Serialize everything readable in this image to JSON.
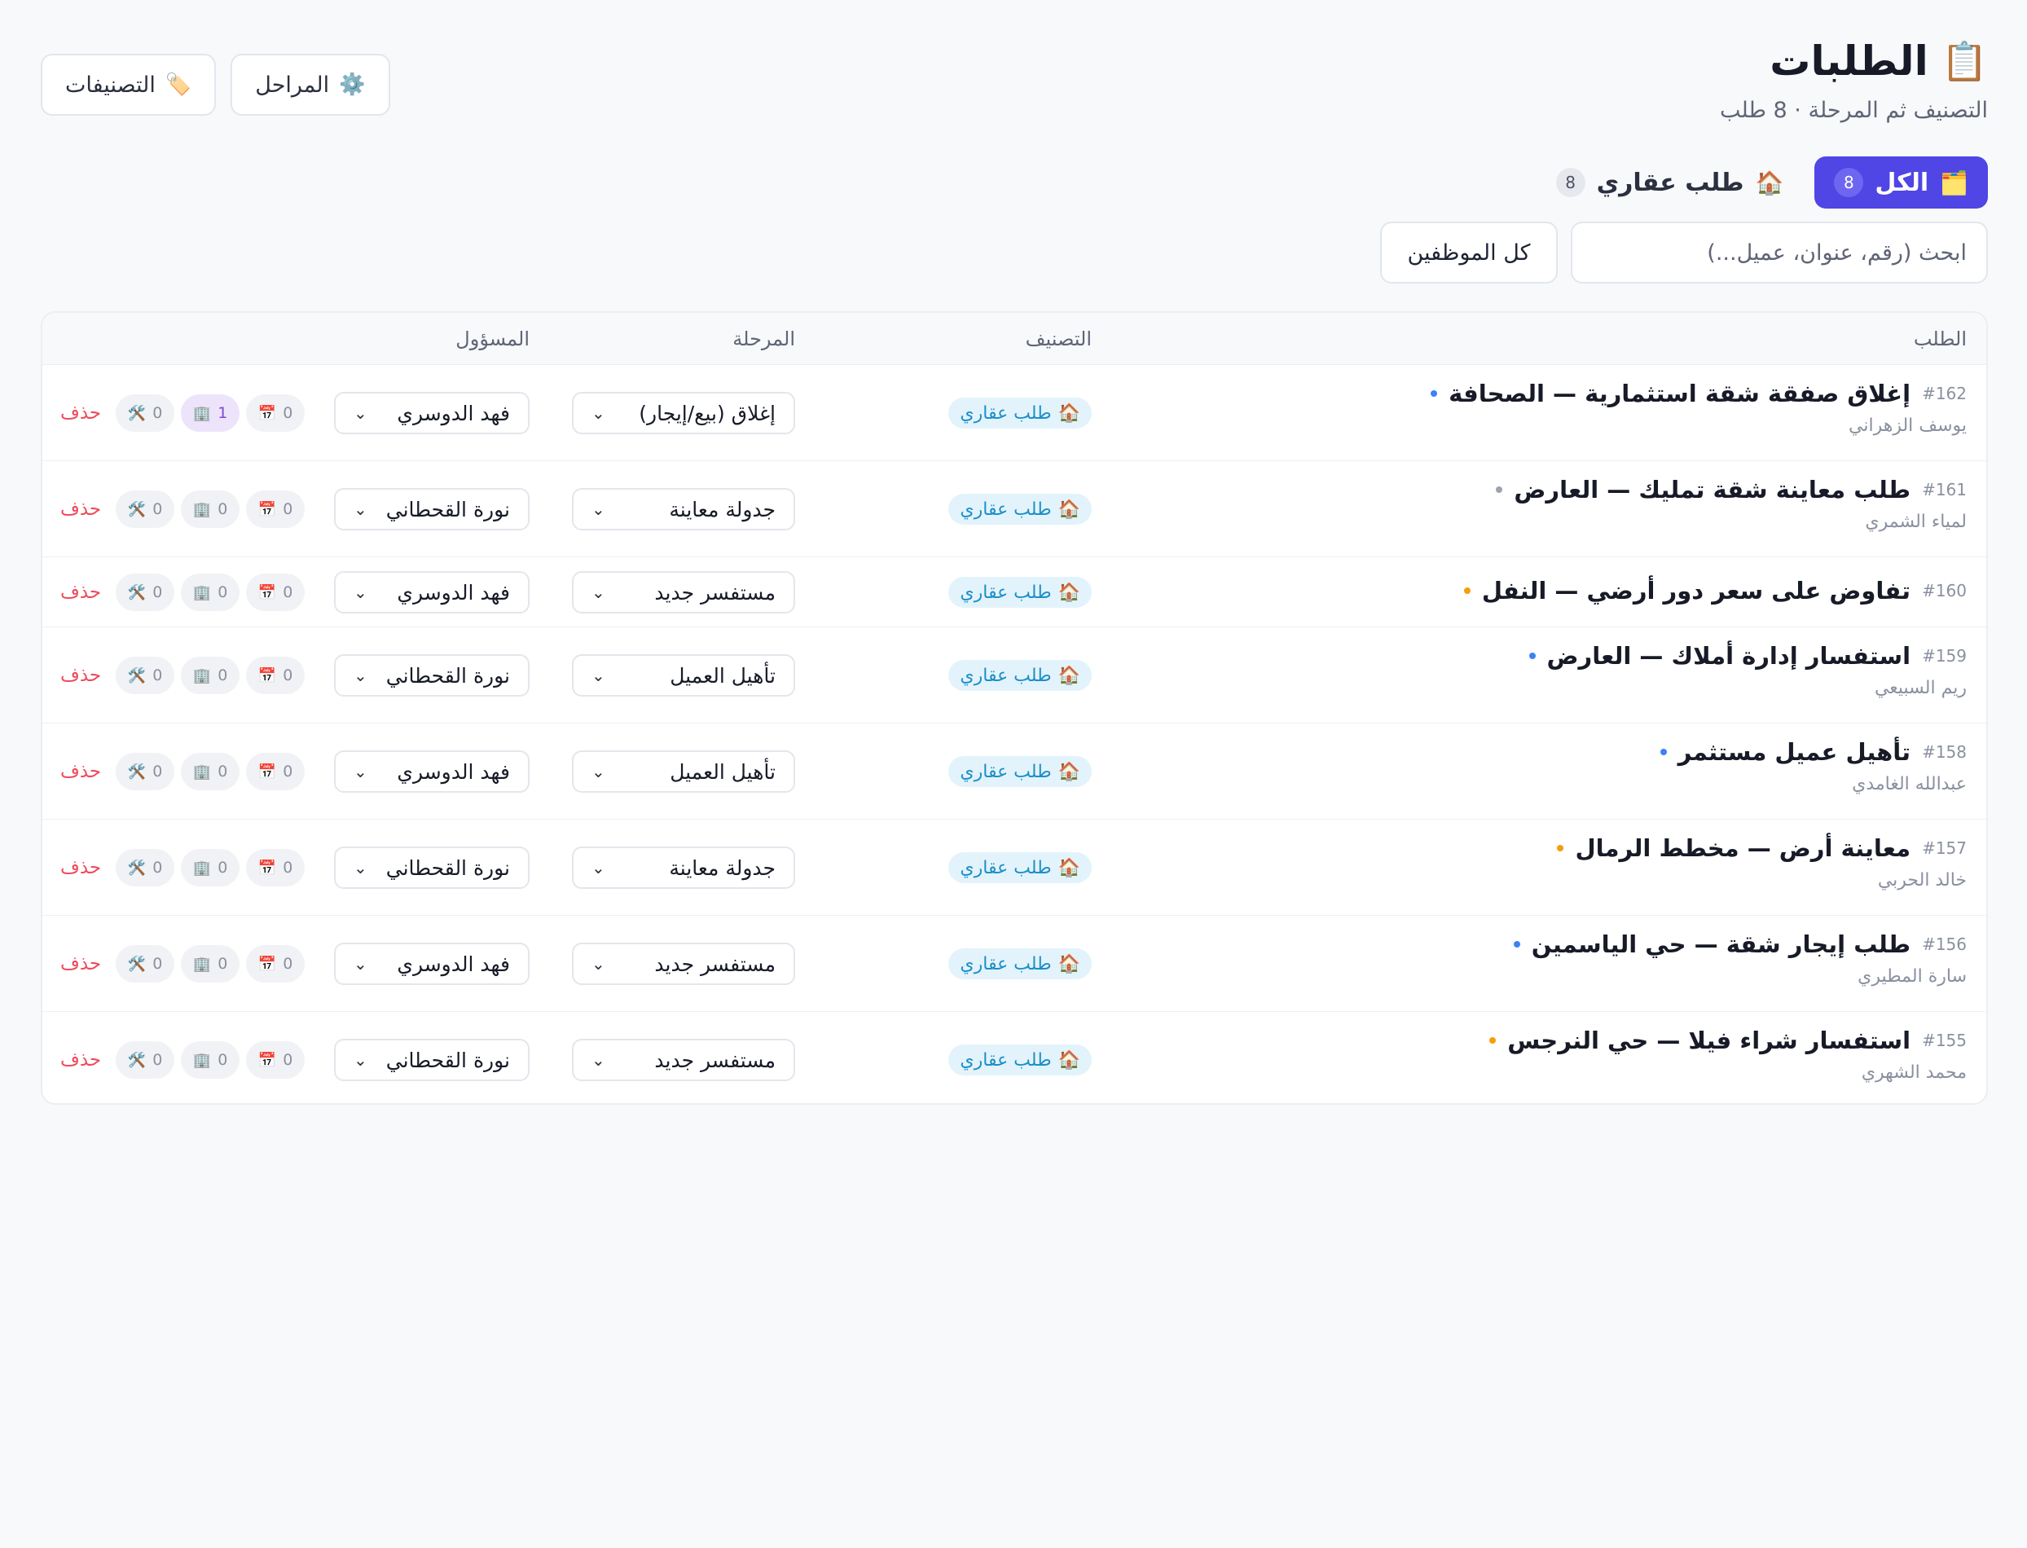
{
  "header": {
    "icon": "clipboard-icon",
    "icon_glyph": "📋",
    "title": "الطلبات",
    "subtitle": "التصنيف ثم المرحلة · 8 طلب"
  },
  "top_buttons": {
    "categories": {
      "label": "التصنيفات",
      "icon": "tag-icon",
      "glyph": "🏷️"
    },
    "stages": {
      "label": "المراحل",
      "icon": "gear-icon",
      "glyph": "⚙️"
    }
  },
  "tabs": [
    {
      "label": "الكل",
      "count": "8",
      "icon": "folder-icon",
      "glyph": "🗂️",
      "active": true
    },
    {
      "label": "طلب عقاري",
      "count": "8",
      "icon": "house-icon",
      "glyph": "🏠",
      "active": false
    }
  ],
  "filters": {
    "search_placeholder": "ابحث (رقم، عنوان، عميل...)",
    "staff_filter": "كل الموظفين"
  },
  "table": {
    "headers": {
      "request": "الطلب",
      "category": "التصنيف",
      "stage": "المرحلة",
      "owner": "المسؤول"
    },
    "delete_label": "حذف",
    "category_glyph": "🏠",
    "rows": [
      {
        "num": "#162",
        "title": "إغلاق صفقة شقة استثمارية — الصحافة",
        "client": "يوسف الزهراني",
        "dot_color": "#3b82f6",
        "category": "طلب عقاري",
        "stage": "إغلاق (بيع/إيجار)",
        "owner": "فهد الدوسري",
        "calendar": "0",
        "docs": "1",
        "tools": "0"
      },
      {
        "num": "#161",
        "title": "طلب معاينة شقة تمليك — العارض",
        "client": "لمياء الشمري",
        "dot_color": "#9ca3af",
        "category": "طلب عقاري",
        "stage": "جدولة معاينة",
        "owner": "نورة القحطاني",
        "calendar": "0",
        "docs": "0",
        "tools": "0"
      },
      {
        "num": "#160",
        "title": "تفاوض على سعر دور أرضي — النفل",
        "client": "",
        "dot_color": "#f59e0b",
        "category": "طلب عقاري",
        "stage": "مستفسر جديد",
        "owner": "فهد الدوسري",
        "calendar": "0",
        "docs": "0",
        "tools": "0"
      },
      {
        "num": "#159",
        "title": "استفسار إدارة أملاك — العارض",
        "client": "ريم السبيعي",
        "dot_color": "#3b82f6",
        "category": "طلب عقاري",
        "stage": "تأهيل العميل",
        "owner": "نورة القحطاني",
        "calendar": "0",
        "docs": "0",
        "tools": "0"
      },
      {
        "num": "#158",
        "title": "تأهيل عميل مستثمر",
        "client": "عبدالله الغامدي",
        "dot_color": "#3b82f6",
        "category": "طلب عقاري",
        "stage": "تأهيل العميل",
        "owner": "فهد الدوسري",
        "calendar": "0",
        "docs": "0",
        "tools": "0"
      },
      {
        "num": "#157",
        "title": "معاينة أرض — مخطط الرمال",
        "client": "خالد الحربي",
        "dot_color": "#f59e0b",
        "category": "طلب عقاري",
        "stage": "جدولة معاينة",
        "owner": "نورة القحطاني",
        "calendar": "0",
        "docs": "0",
        "tools": "0"
      },
      {
        "num": "#156",
        "title": "طلب إيجار شقة — حي الياسمين",
        "client": "سارة المطيري",
        "dot_color": "#3b82f6",
        "category": "طلب عقاري",
        "stage": "مستفسر جديد",
        "owner": "فهد الدوسري",
        "calendar": "0",
        "docs": "0",
        "tools": "0"
      },
      {
        "num": "#155",
        "title": "استفسار شراء فيلا — حي النرجس",
        "client": "محمد الشهري",
        "dot_color": "#f59e0b",
        "category": "طلب عقاري",
        "stage": "مستفسر جديد",
        "owner": "نورة القحطاني",
        "calendar": "0",
        "docs": "0",
        "tools": "0"
      }
    ]
  }
}
